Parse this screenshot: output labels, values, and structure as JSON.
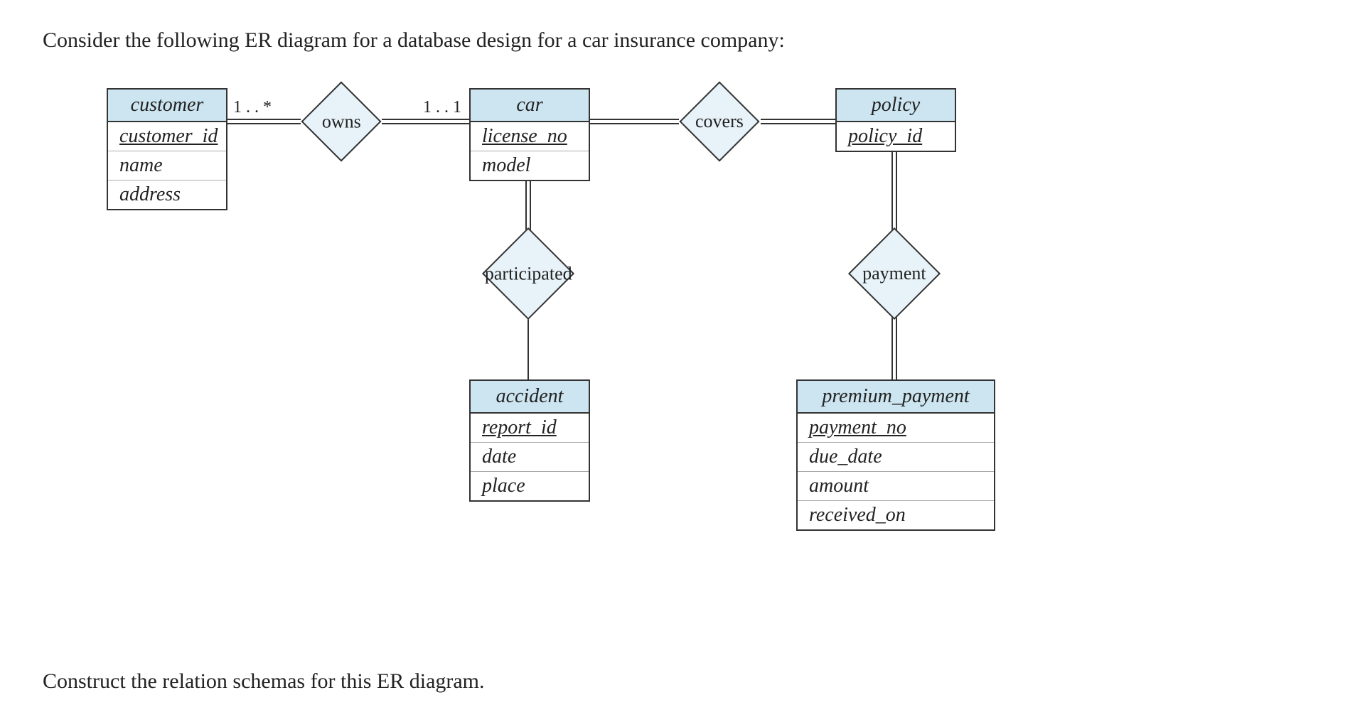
{
  "question": "Consider the following ER diagram for a database design for a car insurance company:",
  "instruction": "Construct the relation schemas for this ER diagram.",
  "entities": {
    "customer": {
      "name": "customer",
      "attrs": [
        "customer_id",
        "name",
        "address"
      ],
      "keys": [
        "customer_id"
      ]
    },
    "car": {
      "name": "car",
      "attrs": [
        "license_no",
        "model"
      ],
      "keys": [
        "license_no"
      ]
    },
    "policy": {
      "name": "policy",
      "attrs": [
        "policy_id"
      ],
      "keys": [
        "policy_id"
      ]
    },
    "accident": {
      "name": "accident",
      "attrs": [
        "report_id",
        "date",
        "place"
      ],
      "keys": [
        "report_id"
      ]
    },
    "premium_payment": {
      "name": "premium_payment",
      "attrs": [
        "payment_no",
        "due_date",
        "amount",
        "received_on"
      ],
      "keys": [
        "payment_no"
      ]
    }
  },
  "relationships": {
    "owns": {
      "label": "owns",
      "card_left": "1 . . *",
      "card_right": "1 . . 1"
    },
    "covers": {
      "label": "covers"
    },
    "participated": {
      "label": "participated"
    },
    "payment": {
      "label": "payment"
    }
  }
}
